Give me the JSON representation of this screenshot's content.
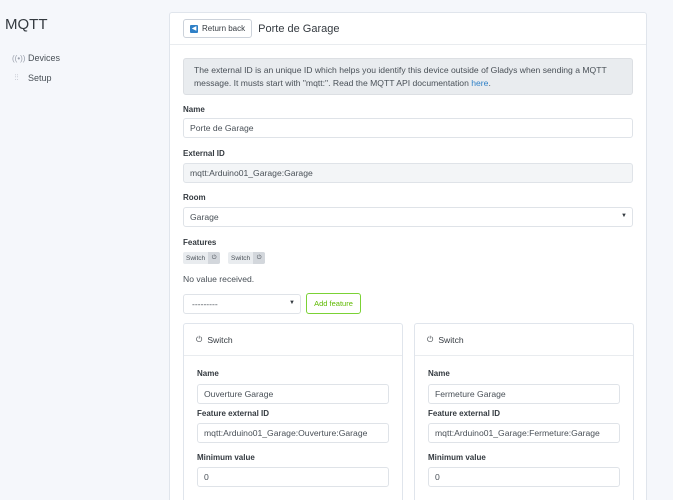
{
  "sidebar": {
    "brand": "MQTT",
    "items": [
      {
        "label": "Devices",
        "icon": "devices-icon"
      },
      {
        "label": "Setup",
        "icon": "sliders-icon"
      }
    ]
  },
  "header": {
    "back_label": "Return back",
    "title": "Porte de Garage"
  },
  "alert": {
    "text_before": "The external ID is an unique ID which helps you identify this device outside of Gladys when sending a MQTT message. It musts start with \"mqtt:\". Read the MQTT API documentation ",
    "link_text": "here",
    "text_after": "."
  },
  "form": {
    "name_label": "Name",
    "name_value": "Porte de Garage",
    "external_id_label": "External ID",
    "external_id_value": "mqtt:Arduino01_Garage:Garage",
    "room_label": "Room",
    "room_value": "Garage",
    "features_label": "Features",
    "feature_badges": [
      "Switch",
      "Switch"
    ],
    "no_value": "No value received.",
    "feature_select": "---------",
    "add_feature": "Add feature"
  },
  "features": [
    {
      "title": "Switch",
      "name_label": "Name",
      "name_value": "Ouverture Garage",
      "ext_label": "Feature external ID",
      "ext_value": "mqtt:Arduino01_Garage:Ouverture:Garage",
      "min_label": "Minimum value",
      "min_value": "0"
    },
    {
      "title": "Switch",
      "name_label": "Name",
      "name_value": "Fermeture Garage",
      "ext_label": "Feature external ID",
      "ext_value": "mqtt:Arduino01_Garage:Fermeture:Garage",
      "min_label": "Minimum value",
      "min_value": "0"
    }
  ],
  "colors": {
    "accent": "#2f80c7",
    "success": "#5eba00",
    "background": "#f5f7fb"
  }
}
